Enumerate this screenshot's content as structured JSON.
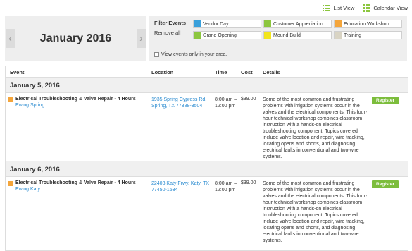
{
  "views": {
    "list_label": "List View",
    "calendar_label": "Calendar View"
  },
  "month_nav": {
    "title": "January 2016",
    "prev_glyph": "‹",
    "next_glyph": "›"
  },
  "filter": {
    "heading": "Filter Events",
    "remove_all": "Remove all",
    "chips": [
      {
        "label": "Vendor Day",
        "color": "#3aa0db"
      },
      {
        "label": "Customer Appreciation",
        "color": "#8cc63f"
      },
      {
        "label": "Education Workshop",
        "color": "#f4a53b"
      },
      {
        "label": "Grand Opening",
        "color": "#8cc63f"
      },
      {
        "label": "Mound Build",
        "color": "#f2e51d"
      },
      {
        "label": "Training",
        "color": "#d9d4c4"
      }
    ],
    "area_checkbox_label": "View events only in your area."
  },
  "table": {
    "headers": {
      "event": "Event",
      "location": "Location",
      "time": "Time",
      "cost": "Cost",
      "details": "Details"
    }
  },
  "days": [
    {
      "date": "January 5, 2016",
      "event": {
        "title": "Electrical Troubleshooting & Valve Repair - 4 Hours",
        "venue": "Ewing Spring",
        "location": "1935 Spring Cypress Rd. Spring, TX 77388-3504",
        "time": "8:00 am – 12:00 pm",
        "cost": "$39.00",
        "details": "Some of the most common and frustrating problems with irrigation systems occur in the valves and the electrical components. This four-hour technical workshop combines classroom instruction with a hands-on electrical troubleshooting component. Topics covered include valve location and repair, wire tracking, locating opens and shorts, and diagnosing electrical faults in conventional and two-wire systems.",
        "register_label": "Register",
        "category_color": "#f4a53b"
      }
    },
    {
      "date": "January 6, 2016",
      "event": {
        "title": "Electrical Troubleshooting & Valve Repair - 4 Hours",
        "venue": "Ewing Katy",
        "location": "22403 Katy Frwy. Katy, TX 77450-1534",
        "time": "8:00 am – 12:00 pm",
        "cost": "$39.00",
        "details": "Some of the most common and frustrating problems with irrigation systems occur in the valves and the electrical components. This four-hour technical workshop combines classroom instruction with a hands-on electrical troubleshooting component. Topics covered include valve location and repair, wire tracking, locating opens and shorts, and diagnosing electrical faults in conventional and two-wire systems.",
        "register_label": "Register",
        "category_color": "#f4a53b"
      }
    }
  ]
}
